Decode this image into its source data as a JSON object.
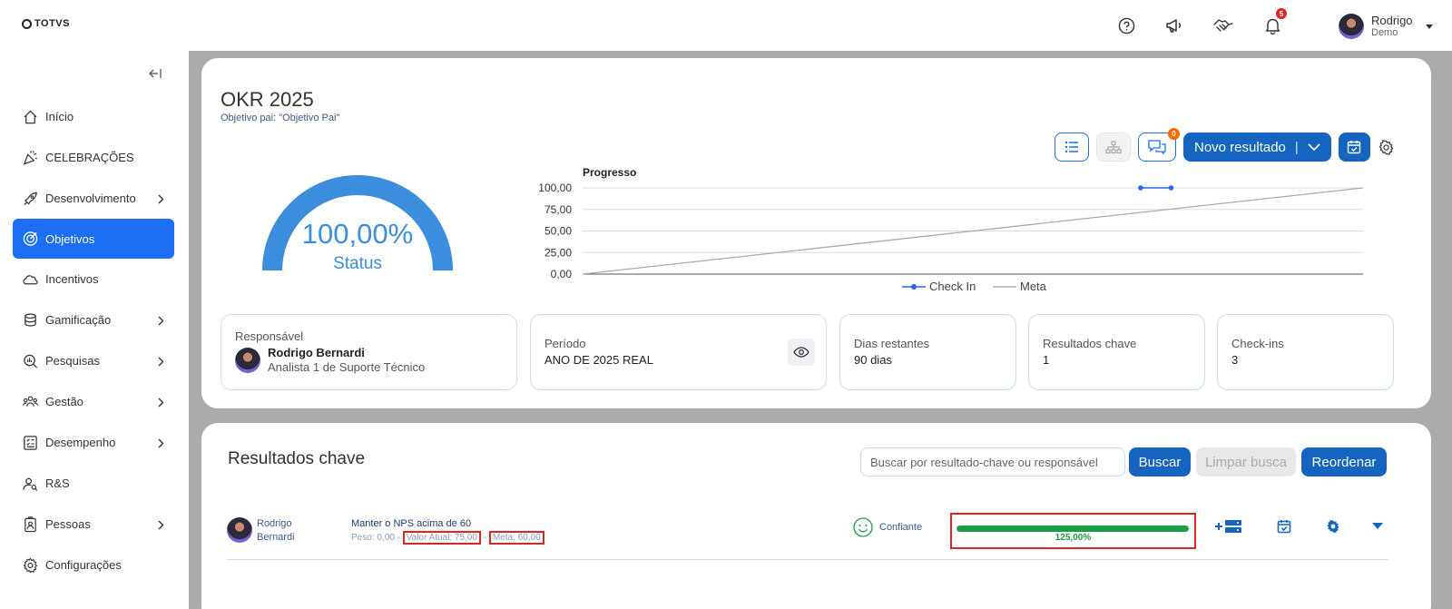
{
  "brand": {
    "logo_text": "TOTVS"
  },
  "header": {
    "notifications_count": "5",
    "user": {
      "name": "Rodrigo",
      "role": "Demo"
    },
    "icons": [
      "help-icon",
      "megaphone-icon",
      "handshake-icon",
      "bell-icon"
    ]
  },
  "sidebar": {
    "items": [
      {
        "label": "Início",
        "icon": "home-icon",
        "has_children": false,
        "active": false
      },
      {
        "label": "CELEBRAÇÕES",
        "icon": "party-icon",
        "has_children": false,
        "active": false
      },
      {
        "label": "Desenvolvimento",
        "icon": "rocket-icon",
        "has_children": true,
        "active": false
      },
      {
        "label": "Objetivos",
        "icon": "target-icon",
        "has_children": false,
        "active": true
      },
      {
        "label": "Incentivos",
        "icon": "cloud-icon",
        "has_children": false,
        "active": false
      },
      {
        "label": "Gamificação",
        "icon": "coins-icon",
        "has_children": true,
        "active": false
      },
      {
        "label": "Pesquisas",
        "icon": "survey-icon",
        "has_children": true,
        "active": false
      },
      {
        "label": "Gestão",
        "icon": "team-icon",
        "has_children": true,
        "active": false
      },
      {
        "label": "Desempenho",
        "icon": "checklist-icon",
        "has_children": true,
        "active": false
      },
      {
        "label": "R&S",
        "icon": "user-search-icon",
        "has_children": false,
        "active": false
      },
      {
        "label": "Pessoas",
        "icon": "badge-icon",
        "has_children": true,
        "active": false
      },
      {
        "label": "Configurações",
        "icon": "gear-icon",
        "has_children": false,
        "active": false
      }
    ]
  },
  "okr": {
    "title": "OKR 2025",
    "parent": "Objetivo pai: \"Objetivo Pai\"",
    "comments_count": "0",
    "new_result_label": "Novo resultado",
    "status_value": "100,00%",
    "status_fraction": 1.0,
    "status_label": "Status"
  },
  "chart_data": {
    "type": "line",
    "title": "Progresso",
    "ylim": [
      0,
      100
    ],
    "yticks": [
      "0,00",
      "25,00",
      "50,00",
      "75,00",
      "100,00"
    ],
    "series": [
      {
        "name": "Check In",
        "color": "#2962ff",
        "points": [
          [
            0.715,
            100
          ],
          [
            0.754,
            100
          ]
        ]
      },
      {
        "name": "Meta",
        "color": "#aaaaaa",
        "points": [
          [
            0,
            0
          ],
          [
            1,
            100
          ]
        ]
      }
    ],
    "legend_position": "bottom"
  },
  "info": {
    "responsible_label": "Responsável",
    "responsible_name": "Rodrigo Bernardi",
    "responsible_role": "Analista 1 de Suporte Técnico",
    "period_label": "Período",
    "period_value": "ANO DE 2025 REAL",
    "days_label": "Dias restantes",
    "days_value": "90 dias",
    "kr_label": "Resultados chave",
    "kr_value": "1",
    "checkins_label": "Check-ins",
    "checkins_value": "3"
  },
  "key_results": {
    "title": "Resultados chave",
    "search_placeholder": "Buscar por resultado-chave ou responsável",
    "search_button": "Buscar",
    "clear_button": "Limpar busca",
    "reorder_button": "Reordenar",
    "rows": [
      {
        "person_first": "Rodrigo",
        "person_last": "Bernardi",
        "name": "Manter o NPS acima de 60",
        "weight": "Peso: 0,00 -",
        "current_value": "Valor Atual: 75,00",
        "separator": "-",
        "goal": "Meta: 60,00",
        "confidence": "Confiante",
        "progress_text": "125,00%",
        "progress_fraction": 1.0
      }
    ]
  }
}
